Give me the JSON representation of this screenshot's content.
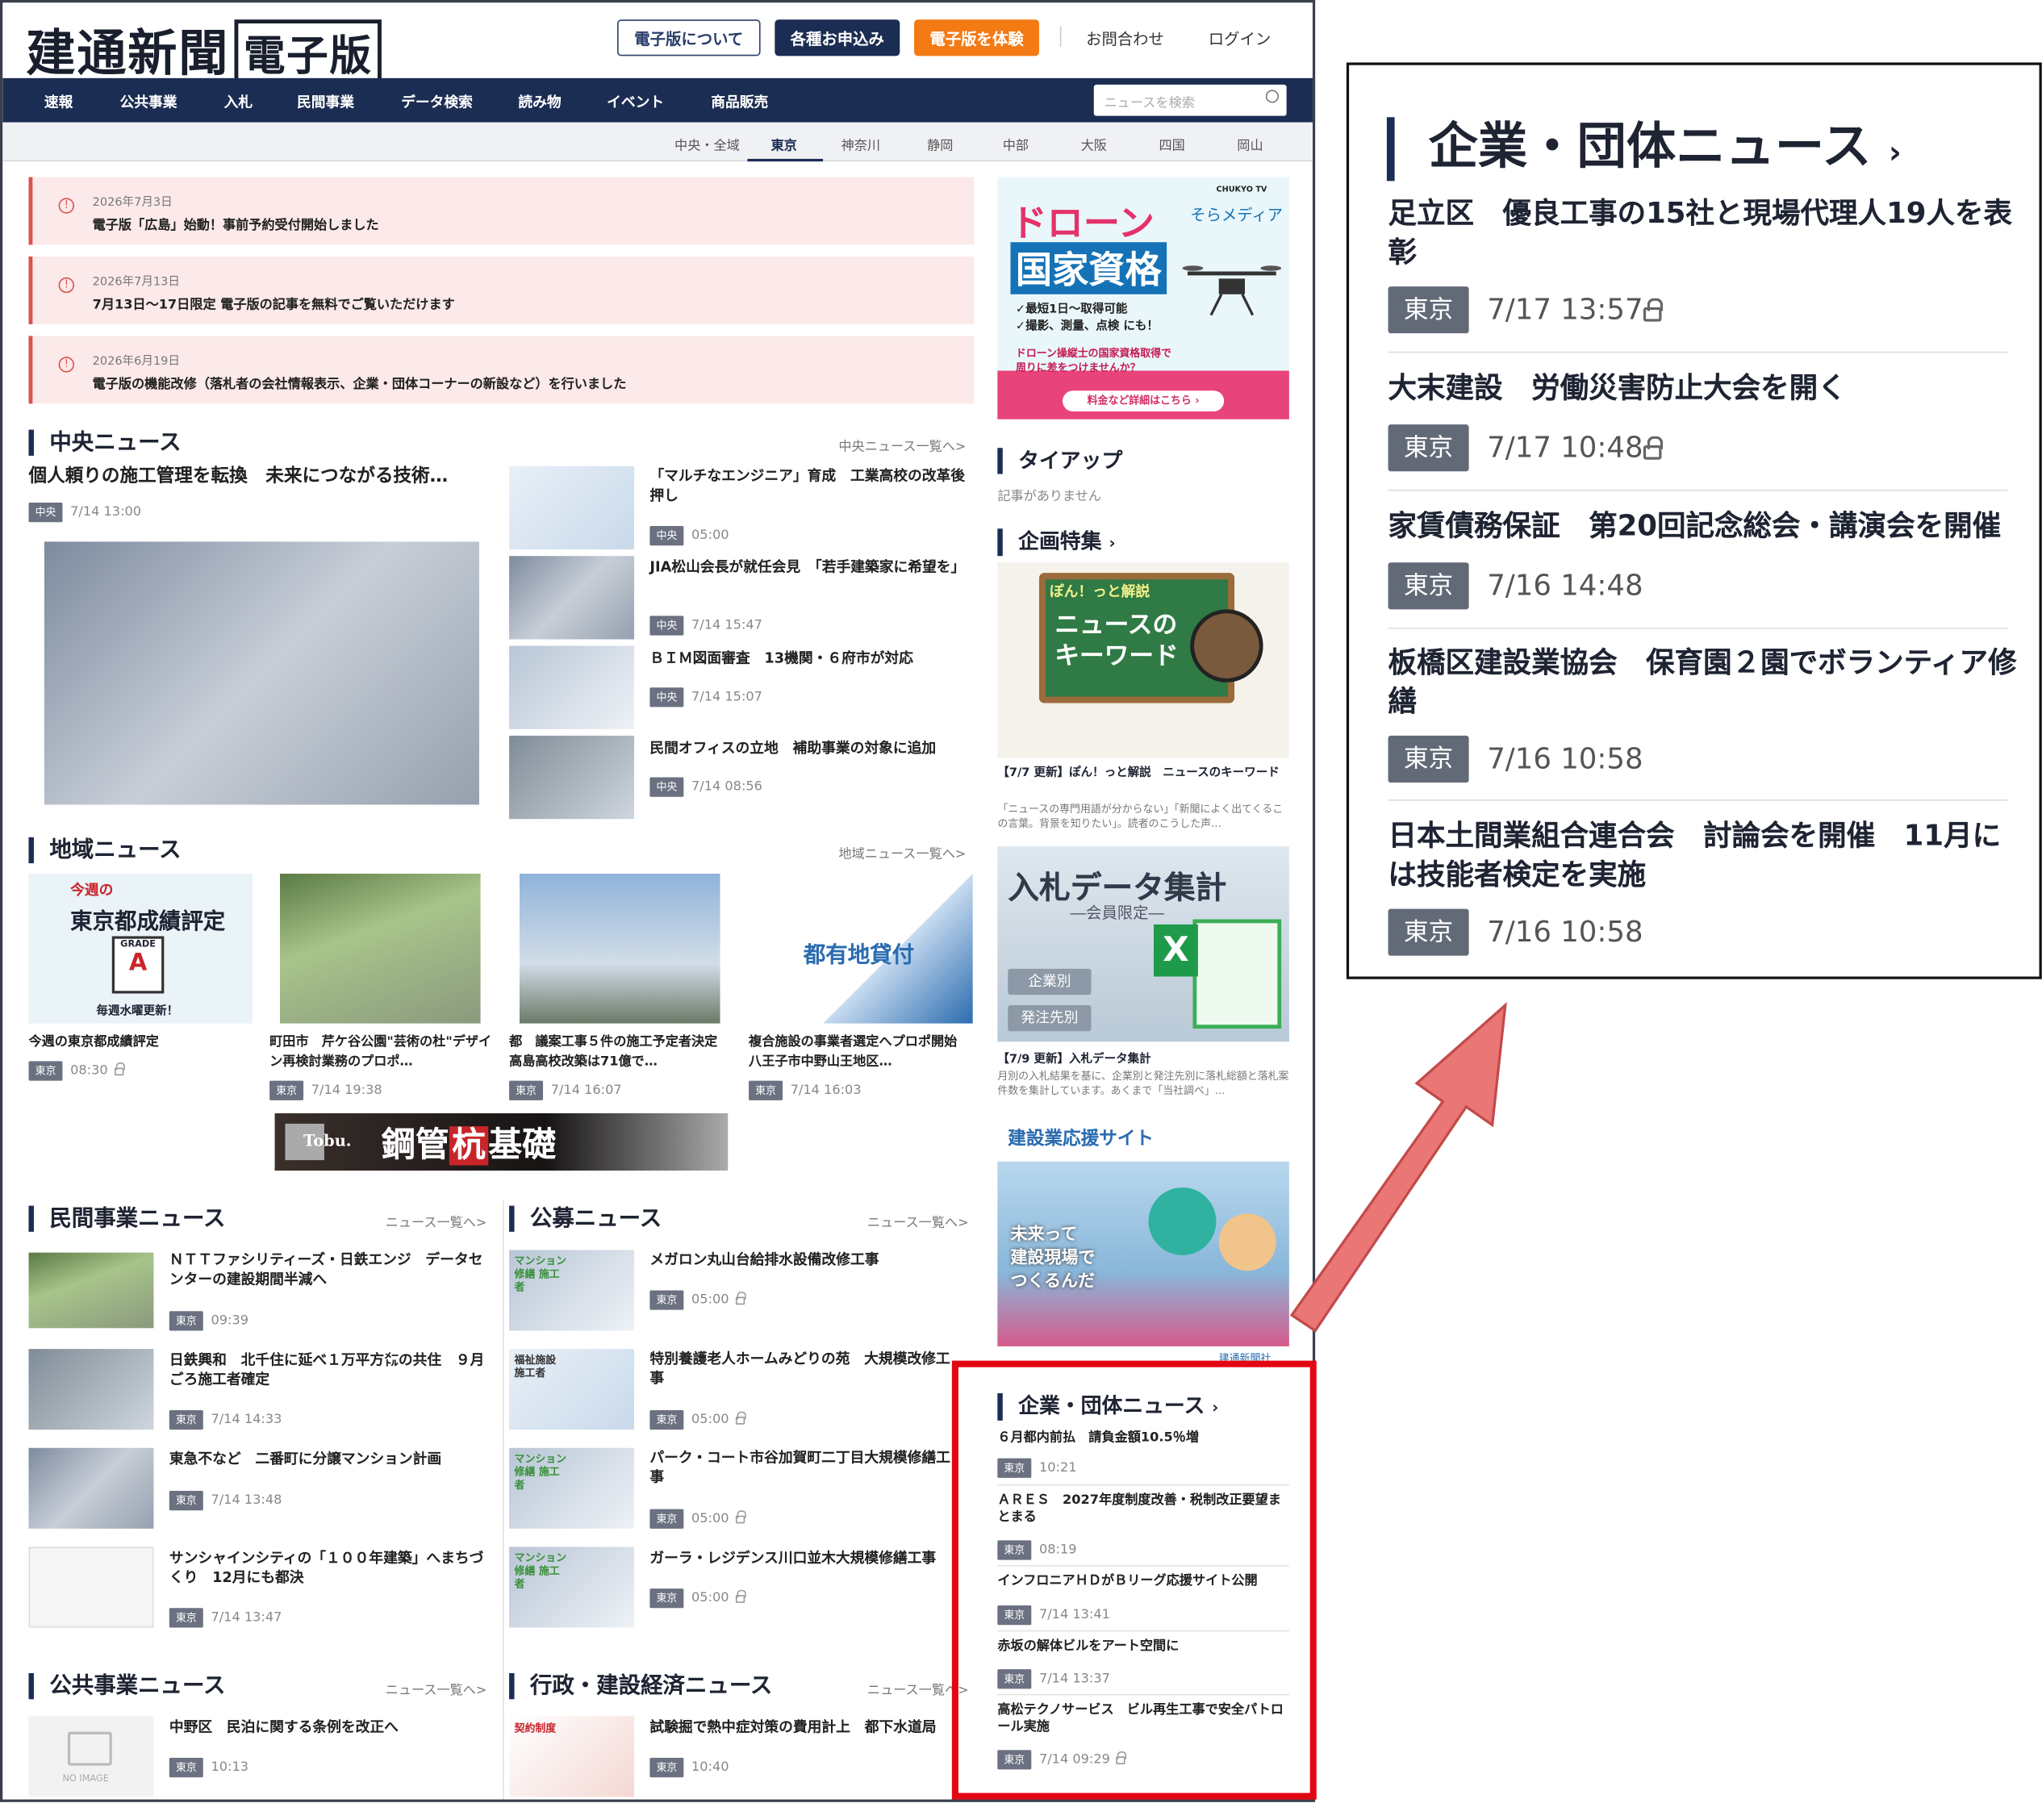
{
  "header": {
    "logo_text": "建通新聞",
    "logo_box": "電子版",
    "about": "電子版について",
    "apply": "各種お申込み",
    "trial": "電子版を体験",
    "contact": "お問合わせ",
    "login": "ログイン",
    "search_placeholder": "ニュースを検索"
  },
  "nav": [
    "速報",
    "公共事業",
    "入札",
    "民間事業",
    "データ検索",
    "読み物",
    "イベント",
    "商品販売"
  ],
  "regions": [
    "中央・全域",
    "東京",
    "神奈川",
    "静岡",
    "中部",
    "大阪",
    "四国",
    "岡山"
  ],
  "active_region": "東京",
  "notices": [
    {
      "date": "2026年7月3日",
      "text": "電子版「広島」始動！事前予約受付開始しました"
    },
    {
      "date": "2026年7月13日",
      "text": "7月13日～17日限定 電子版の記事を無料でご覧いただけます"
    },
    {
      "date": "2026年6月19日",
      "text": "電子版の機能改修（落札者の会社情報表示、企業・団体コーナーの新設など）を行いました"
    }
  ],
  "central": {
    "title": "中央ニュース",
    "more": "中央ニュース一覧へ>",
    "lead": {
      "title": "個人頼りの施工管理を転換　未来につながる技術…",
      "tag": "中央",
      "time": "7/14 13:00"
    },
    "items": [
      {
        "title": "「マルチなエンジニア」育成　工業高校の改革後押し",
        "tag": "中央",
        "time": "05:00"
      },
      {
        "title": "JIA松山会長が就任会見　「若手建築家に希望を」",
        "tag": "中央",
        "time": "7/14 15:47"
      },
      {
        "title": "ＢＩＭ図面審査　13機関・６府市が対応",
        "tag": "中央",
        "time": "7/14 15:07"
      },
      {
        "title": "民間オフィスの立地　補助事業の対象に追加",
        "tag": "中央",
        "time": "7/14 08:56"
      }
    ]
  },
  "regional": {
    "title": "地域ニュース",
    "more": "地域ニュース一覧へ>",
    "card1": {
      "week": "今週の",
      "headline": "東京都成績評定",
      "grade": "GRADE",
      "update": "毎週水曜更新！"
    },
    "card4": {
      "headline": "都有地貸付"
    },
    "items": [
      {
        "title": "今週の東京都成績評定",
        "tag": "東京",
        "time": "08:30"
      },
      {
        "title": "町田市　芹ケ谷公園\"芸術の杜\"デザイン再検討業務のプロポ…",
        "tag": "東京",
        "time": "7/14 19:38"
      },
      {
        "title": "都　議案工事５件の施工予定者決定　高島高校改築は71億で…",
        "tag": "東京",
        "time": "7/14 16:07"
      },
      {
        "title": "複合施設の事業者選定へプロポ開始　八王子市中野山王地区…",
        "tag": "東京",
        "time": "7/14 16:03"
      }
    ]
  },
  "banner": {
    "brand": "Tobu.",
    "text1": "鋼管",
    "text2": "杭",
    "text3": "基礎"
  },
  "private": {
    "title": "民間事業ニュース",
    "more": "ニュース一覧へ>",
    "items": [
      {
        "title": "ＮＴＴファシリティーズ・日鉄エンジ　データセンターの建設期間半減へ",
        "tag": "東京",
        "time": "09:39"
      },
      {
        "title": "日鉄興和　北千住に延べ１万平方㍍の共住　９月ごろ施工者確定",
        "tag": "東京",
        "time": "7/14 14:33"
      },
      {
        "title": "東急不など　二番町に分譲マンション計画",
        "tag": "東京",
        "time": "7/14 13:48"
      },
      {
        "title": "サンシャインシティの「１００年建築」へまちづくり　12月にも都決",
        "tag": "東京",
        "time": "7/14 13:47"
      }
    ]
  },
  "public_bid": {
    "title": "公募ニュース",
    "more": "ニュース一覧へ>",
    "items": [
      {
        "label": "マンション修繕 施工者",
        "title": "メガロン丸山台給排水設備改修工事",
        "tag": "東京",
        "time": "05:00"
      },
      {
        "label": "福祉施設 施工者",
        "title": "特別養護老人ホームみどりの苑　大規模改修工事",
        "tag": "東京",
        "time": "05:00"
      },
      {
        "label": "マンション修繕 施工者",
        "title": "パーク・コート市谷加賀町二丁目大規模修繕工事",
        "tag": "東京",
        "time": "05:00"
      },
      {
        "label": "マンション修繕 施工者",
        "title": "ガーラ・レジデンス川口並木大規模修繕工事",
        "tag": "東京",
        "time": "05:00"
      }
    ]
  },
  "public_works": {
    "title": "公共事業ニュース",
    "more": "ニュース一覧へ>",
    "noimage": "NO IMAGE",
    "items": [
      {
        "title": "中野区　民泊に関する条例を改正へ",
        "tag": "東京",
        "time": "10:13"
      }
    ]
  },
  "admin": {
    "title": "行政・建設経済ニュース",
    "more": "ニュース一覧へ>",
    "items": [
      {
        "label": "契約制度",
        "title": "試験掘で熱中症対策の費用計上　都下水道局",
        "tag": "東京",
        "time": "10:40"
      }
    ]
  },
  "sidebar": {
    "drone": {
      "t1": "ドローン",
      "t2": "国家資格",
      "brand": "CHUKYO TV",
      "media": "そらメディア",
      "l1": "✓最短1日〜取得可能",
      "l2": "✓撮影、測量、点検 にも！",
      "l3": "ドローン操縦士の国家資格取得で",
      "l4": "周りに差をつけませんか？",
      "cta": "料金など詳細はこちら ›"
    },
    "tieup": {
      "title": "タイアップ",
      "empty": "記事がありません"
    },
    "feature": {
      "title": "企画特集",
      "bubble": "ぽん！っと解説",
      "kw1": "ニュースの",
      "kw2": "キーワード",
      "caption": "【7/7 更新】ぽん！っと解説　ニュースのキーワード",
      "desc": "「ニュースの専門用語が分からない」「新聞によく出てくるこの言葉。背景を知りたい」。読者のこうした声…"
    },
    "data": {
      "h": "入札データ集計",
      "s": "―会員限定―",
      "b1": "企業別",
      "b2": "発注先別",
      "caption": "【7/9 更新】入札データ集計",
      "desc": "月別の入札結果を基に、企業別と発注先別に落札総額と落札案件数を集計しています。あくまで「当社調べ」…"
    },
    "support": {
      "title": "建設業応援サイト",
      "line1": "未来って",
      "line2": "建設現場で",
      "line3": "つくるんだ",
      "credit": "建通新聞社"
    },
    "corp": {
      "title": "企業・団体ニュース",
      "items": [
        {
          "title": "６月都内前払　請負金額10.5％増",
          "tag": "東京",
          "time": "10:21"
        },
        {
          "title": "ＡＲＥＳ　2027年度制度改善・税制改正要望まとまる",
          "tag": "東京",
          "time": "08:19"
        },
        {
          "title": "インフロニアＨＤがＢリーグ応援サイト公開",
          "tag": "東京",
          "time": "7/14 13:41"
        },
        {
          "title": "赤坂の解体ビルをアート空間に",
          "tag": "東京",
          "time": "7/14 13:37"
        },
        {
          "title": "高松テクノサービス　ビル再生工事で安全パトロール実施",
          "tag": "東京",
          "time": "7/14 09:29"
        }
      ]
    }
  },
  "zoom": {
    "title": "企業・団体ニュース",
    "items": [
      {
        "title": "足立区　優良工事の15社と現場代理人19人を表彰",
        "tag": "東京",
        "time": "7/17 13:57"
      },
      {
        "title": "大末建設　労働災害防止大会を開く",
        "tag": "東京",
        "time": "7/17 10:48"
      },
      {
        "title": "家賃債務保証　第20回記念総会・講演会を開催",
        "tag": "東京",
        "time": "7/16 14:48"
      },
      {
        "title": "板橋区建設業協会　保育園２園でボランティア修繕",
        "tag": "東京",
        "time": "7/16 10:58"
      },
      {
        "title": "日本土間業組合連合会　討論会を開催　11月には技能者検定を実施",
        "tag": "東京",
        "time": "7/16 10:58"
      }
    ]
  },
  "colors": {
    "navy": "#1b2d52",
    "orange": "#f47a14",
    "highlight": "#e30613",
    "arrow": "#e86a6a"
  }
}
